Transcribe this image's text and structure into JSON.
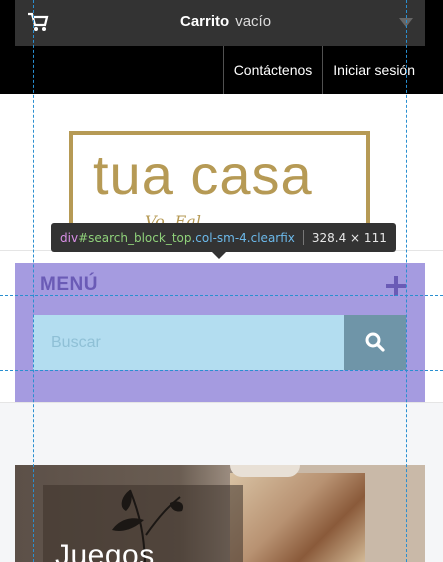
{
  "cart": {
    "title": "Carrito",
    "status": "vacío"
  },
  "nav": {
    "links": [
      "Contáctenos",
      "Iniciar sesión"
    ]
  },
  "logo": {
    "text": "tua casa",
    "script": "Vo. Eal..."
  },
  "devtools_tooltip": {
    "tag": "div",
    "id": "#search_block_top",
    "classes": ".col-sm-4.clearfix",
    "size": "328.4 × 111"
  },
  "menu": {
    "label": "MENÚ"
  },
  "search": {
    "placeholder": "Buscar"
  },
  "banner": {
    "title": "Juegos"
  },
  "colors": {
    "highlight": "#a59be0",
    "search_bg": "#b3ddf0",
    "search_button": "#6f95a8",
    "logo_gold": "#b69a55",
    "guide_blue": "#2a8fd0"
  }
}
